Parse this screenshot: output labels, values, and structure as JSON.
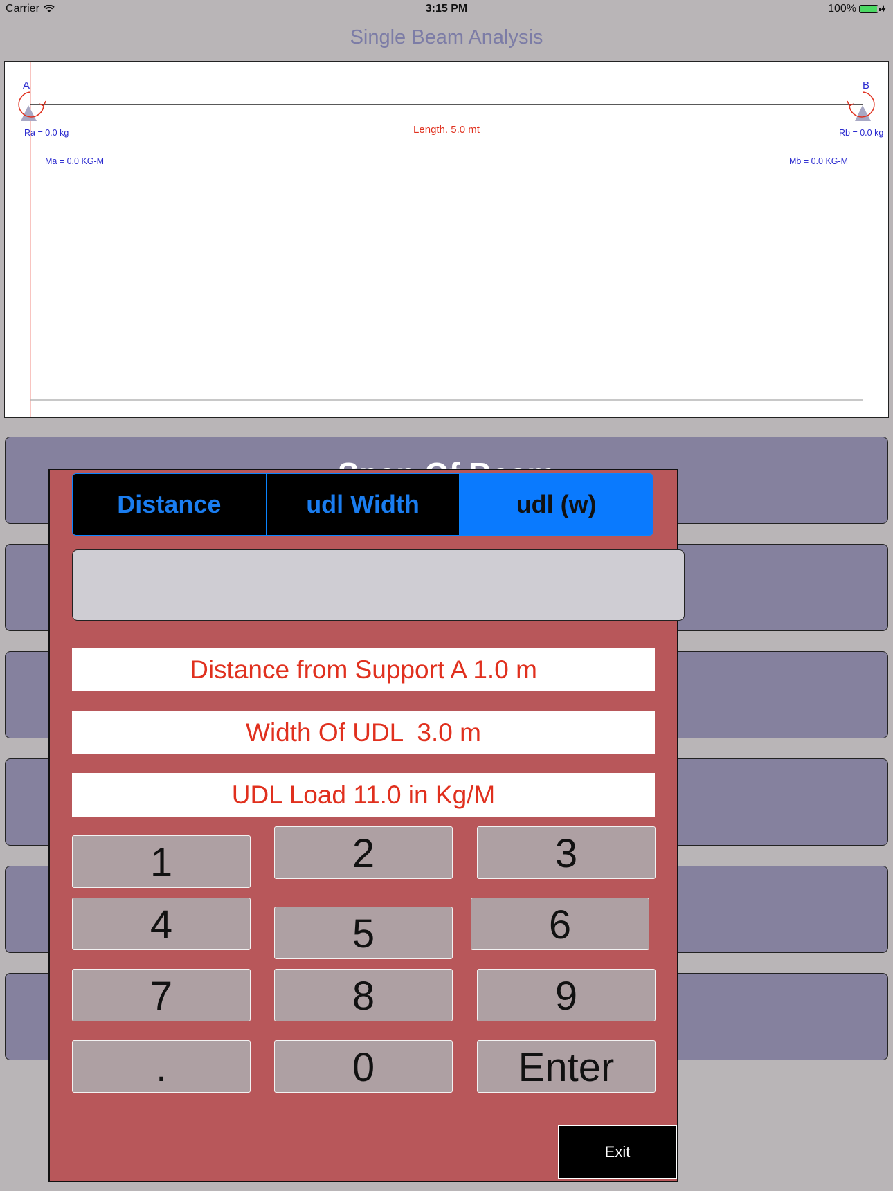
{
  "status_bar": {
    "carrier": "Carrier",
    "time": "3:15 PM",
    "battery": "100%"
  },
  "app_title": "Single Beam Analysis",
  "beam": {
    "support_a": "A",
    "support_b": "B",
    "length": "Length. 5.0 mt",
    "ra": "Ra = 0.0 kg",
    "rb": "Rb = 0.0 kg",
    "ma": "Ma = 0.0 KG-M",
    "mb": "Mb = 0.0 KG-M"
  },
  "background_panel_title": "Span Of Beam",
  "modal": {
    "tabs": [
      "Distance",
      "udl Width",
      "udl (w)"
    ],
    "active_tab": 2,
    "entry_value": "",
    "info_distance": "Distance from Support A 1.0 m",
    "info_width": "Width Of UDL  3.0 m",
    "info_load": "UDL Load 11.0 in Kg/M",
    "keys": [
      "1",
      "2",
      "3",
      "4",
      "5",
      "6",
      "7",
      "8",
      "9",
      ".",
      "0",
      "Enter"
    ],
    "exit_label": "Exit"
  },
  "colors": {
    "background": "#b9b5b7",
    "modal": "#b8575a",
    "accent": "#0a7afe",
    "panel": "#85819e",
    "label_red": "#e0301e",
    "label_blue": "#2b2bcf"
  }
}
